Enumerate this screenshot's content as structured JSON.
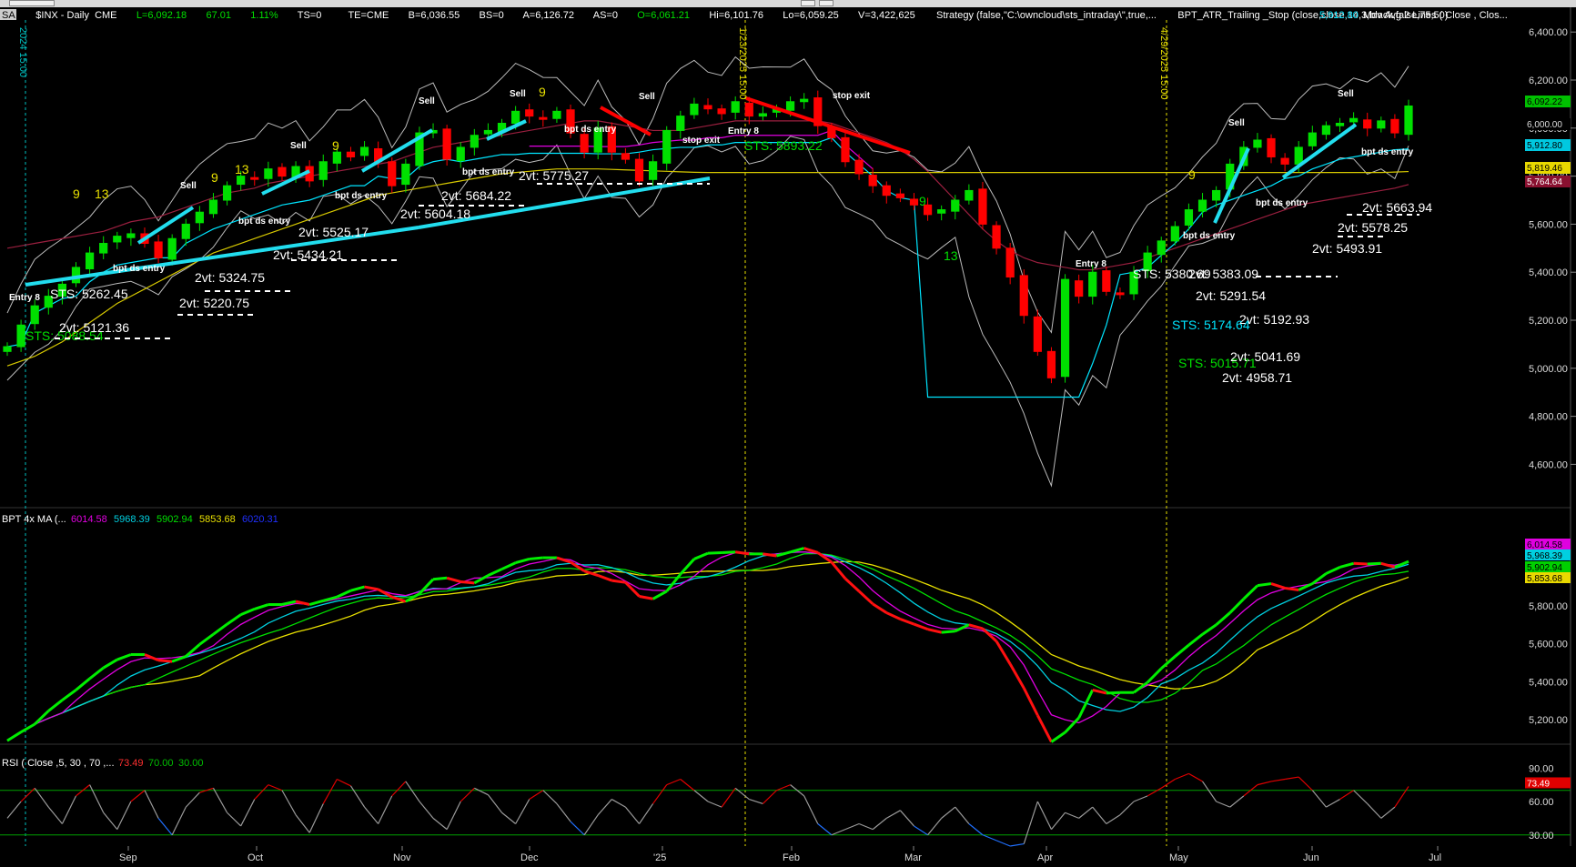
{
  "toolbar": {
    "tag": "SA"
  },
  "header": {
    "symbol": "$INX - Daily  CME",
    "last": "L=6,092.18",
    "change": "67.01",
    "change_pct": "1.11%",
    "ts": "TS=0",
    "te": "TE=CME",
    "bid": "B=6,036.55",
    "bs": "BS=0",
    "ask": "A=6,126.72",
    "as": "AS=0",
    "open": "O=6,061.21",
    "high": "Hi=6,101.76",
    "low": "Lo=6,059.25",
    "volume": "V=3,422,625",
    "strategy": "Strategy (false,\"C:\\owncloud\\sts_intraday\\\",true,...",
    "atr_stop": "BPT_ATR_Trailing _Stop (close,close,14,3,black,false,75,50)",
    "atr_value": "5,912.80",
    "mov_avg": "Mov Avg 2 Lines ( Close , Clos..."
  },
  "colors": {
    "background": "#000000",
    "up_candle": "#00e000",
    "down_candle": "#ff0000",
    "trailing_stop": "#00e5ff",
    "sma200": "#d6c800",
    "sma50": "#9a1f3f",
    "bollinger": "#bbbbbb",
    "magenta": "#e000e0",
    "trendline": "#22ddee"
  },
  "chart_data": [
    {
      "type": "candlestick",
      "title": "$INX - Daily",
      "ylim": [
        4450,
        6450
      ],
      "y_ticks": [
        "6,400.00",
        "6,200.00",
        "6,000.00",
        "5,800.00",
        "5,600.00",
        "5,400.00",
        "5,200.00",
        "5,000.00",
        "4,800.00",
        "4,600.00"
      ],
      "x_ticks": [
        "Sep",
        "Oct",
        "Nov",
        "Dec",
        "'25",
        "Feb",
        "Mar",
        "Apr",
        "May",
        "Jun",
        "Jul"
      ],
      "right_badges": [
        {
          "text": "6,092.22",
          "bg": "#00c000",
          "fg": "#000"
        },
        {
          "text": "6,000.00",
          "bg": "#000",
          "fg": "#ddd"
        },
        {
          "text": "5,912.80",
          "bg": "#00c8e0",
          "fg": "#000"
        },
        {
          "text": "5,819.46",
          "bg": "#e8d800",
          "fg": "#000"
        },
        {
          "text": "5,764.64",
          "bg": "#8a1030",
          "fg": "#fff"
        }
      ],
      "date_markers": [
        "2024 15:00",
        "1/23/2025 15:00",
        "4/29/2025 15:00"
      ],
      "series": [
        {
          "name": "Close",
          "values": [
            5090,
            5180,
            5260,
            5300,
            5350,
            5420,
            5480,
            5520,
            5550,
            5560,
            5520,
            5460,
            5540,
            5600,
            5650,
            5700,
            5760,
            5800,
            5790,
            5830,
            5800,
            5840,
            5780,
            5860,
            5900,
            5880,
            5920,
            5860,
            5760,
            5850,
            5980,
            5990,
            5870,
            5920,
            5970,
            5990,
            6020,
            6070,
            6050,
            6040,
            6070,
            5980,
            5900,
            6000,
            5900,
            5870,
            5780,
            5860,
            5990,
            6050,
            6100,
            6080,
            6060,
            6110,
            6050,
            6060,
            6080,
            6110,
            6120,
            6010,
            5960,
            5860,
            5810,
            5760,
            5720,
            5710,
            5680,
            5640,
            5660,
            5700,
            5740,
            5600,
            5500,
            5380,
            5220,
            5070,
            4960,
            5370,
            5300,
            5400,
            5320,
            5310,
            5400,
            5480,
            5530,
            5590,
            5660,
            5700,
            5740,
            5850,
            5920,
            5950,
            5880,
            5850,
            5920,
            5980,
            6010,
            6020,
            6040,
            6000,
            6030,
            5980,
            6092
          ]
        },
        {
          "name": "ATR Trailing Stop",
          "values": [
            5090,
            5100,
            5230,
            5260,
            5290,
            5300,
            5360,
            5400,
            5430,
            5440,
            5450,
            5460,
            5460,
            5520,
            5550,
            5580,
            5600,
            5620,
            5640,
            5660,
            5680,
            5690,
            5700,
            5720,
            5740,
            5760,
            5760,
            5800,
            5790,
            5790,
            5840,
            5860,
            5870,
            5860,
            5870,
            5880,
            5890,
            5890,
            5895,
            5895,
            5895,
            5895,
            5895,
            5893,
            5893,
            5893,
            5900,
            5910,
            5915,
            5920,
            5920,
            5930,
            5930,
            5940,
            5940,
            5940,
            5940,
            5940,
            5940,
            5940,
            5960,
            5900,
            5850,
            5800,
            5740,
            5710,
            5700,
            4880,
            4880,
            4880,
            4880,
            4880,
            4880,
            4880,
            4880,
            4880,
            4880,
            4880,
            4880,
            5020,
            5180,
            5390,
            5400,
            5420,
            5470,
            5520,
            5580,
            5650,
            5680,
            5700,
            5720,
            5740,
            5760,
            5790,
            5800,
            5830,
            5850,
            5870,
            5880,
            5890,
            5900,
            5910,
            5913
          ]
        },
        {
          "name": "SMA 200",
          "values": [
            5010,
            5030,
            5050,
            5080,
            5110,
            5150,
            5190,
            5230,
            5270,
            5300,
            5330,
            5360,
            5390,
            5420,
            5450,
            5480,
            5500,
            5520,
            5540,
            5560,
            5580,
            5600,
            5620,
            5640,
            5660,
            5680,
            5700,
            5720,
            5730,
            5740,
            5750,
            5760,
            5770,
            5780,
            5790,
            5800,
            5810,
            5815,
            5820,
            5825,
            5830,
            5830,
            5830,
            5830,
            5828,
            5826,
            5824,
            5822,
            5820,
            5818,
            5816,
            5815,
            5815,
            5815,
            5815,
            5815,
            5815,
            5815,
            5815,
            5815,
            5815,
            5815,
            5815,
            5815,
            5815,
            5815,
            5815,
            5815,
            5815,
            5815,
            5815,
            5815,
            5815,
            5815,
            5815,
            5815,
            5815,
            5815,
            5815,
            5815,
            5815,
            5815,
            5815,
            5815,
            5815,
            5815,
            5815,
            5815,
            5815,
            5815,
            5815,
            5815,
            5815,
            5815,
            5815,
            5815,
            5815,
            5815,
            5815,
            5815,
            5815,
            5817,
            5819
          ]
        },
        {
          "name": "SMA 50",
          "values": [
            5500,
            5510,
            5520,
            5530,
            5540,
            5550,
            5560,
            5570,
            5590,
            5610,
            5620,
            5630,
            5650,
            5670,
            5690,
            5710,
            5730,
            5740,
            5750,
            5770,
            5780,
            5790,
            5800,
            5810,
            5820,
            5830,
            5840,
            5850,
            5860,
            5880,
            5900,
            5920,
            5930,
            5940,
            5950,
            5960,
            5970,
            5980,
            5990,
            6000,
            6010,
            6020,
            6030,
            6030,
            6020,
            6010,
            6000,
            5990,
            5990,
            5990,
            6000,
            6010,
            6020,
            6030,
            6030,
            6030,
            6030,
            6030,
            6030,
            6030,
            6020,
            6000,
            5980,
            5960,
            5940,
            5910,
            5870,
            5820,
            5760,
            5700,
            5640,
            5580,
            5530,
            5490,
            5460,
            5440,
            5430,
            5420,
            5410,
            5410,
            5420,
            5430,
            5440,
            5460,
            5480,
            5500,
            5520,
            5540,
            5560,
            5580,
            5600,
            5620,
            5640,
            5660,
            5680,
            5690,
            5700,
            5710,
            5720,
            5730,
            5740,
            5750,
            5765
          ]
        }
      ],
      "annotations": [
        "Entry 8",
        "STS: 5262.45",
        "STS: 5088.54",
        "2vt: 5121.36",
        "2vt: 5220.75",
        "2vt: 5324.75",
        "2vt: 5434.21",
        "2vt: 5525.17",
        "2vt: 5604.18",
        "2vt: 5684.22",
        "2vt: 5775.27",
        "STS: 5893.22",
        "stop exit",
        "Entry 8",
        "STS: 5380.69",
        "2vt: 5383.09",
        "2vt: 5291.54",
        "2vt: 5192.93",
        "STS: 5174.64",
        "STS: 5015.71",
        "2vt: 5041.69",
        "2vt: 4958.71",
        "2vt: 5663.94",
        "2vt: 5578.25",
        "2vt: 5493.91",
        "bpt ds entry",
        "Sell",
        "9",
        "13"
      ]
    },
    {
      "type": "line",
      "title": "BPT 4x MA (...",
      "ylim": [
        5100,
        6250
      ],
      "y_ticks": [
        "5,800.00",
        "5,600.00",
        "5,400.00",
        "5,200.00"
      ],
      "legend_values": [
        {
          "text": "6014.58",
          "color": "#e000e0"
        },
        {
          "text": "5968.39",
          "color": "#00d0e0"
        },
        {
          "text": "5902.94",
          "color": "#00e000"
        },
        {
          "text": "5853.68",
          "color": "#e8e000"
        },
        {
          "text": "6020.31",
          "color": "#2030ff"
        }
      ],
      "right_badges": [
        {
          "text": "6,014.58",
          "bg": "#e000e0",
          "fg": "#000"
        },
        {
          "text": "5,968.39",
          "bg": "#00d0e0",
          "fg": "#000"
        },
        {
          "text": "5,902.94",
          "bg": "#00d000",
          "fg": "#000"
        },
        {
          "text": "5,853.68",
          "bg": "#e8d800",
          "fg": "#000"
        }
      ]
    },
    {
      "type": "line",
      "title": "RSI ( Close ,5, 30 , 70 ,...",
      "ylim": [
        20,
        100
      ],
      "y_ticks": [
        "90.00",
        "60.00",
        "30.00"
      ],
      "levels": [
        70,
        30
      ],
      "legend_values": [
        {
          "text": "73.49",
          "color": "#ff3030"
        },
        {
          "text": "70.00",
          "color": "#00c000"
        },
        {
          "text": "30.00",
          "color": "#00c000"
        }
      ],
      "right_badges": [
        {
          "text": "73.49",
          "bg": "#e00000",
          "fg": "#fff"
        }
      ],
      "values": [
        45,
        60,
        72,
        55,
        40,
        65,
        75,
        50,
        35,
        60,
        70,
        45,
        30,
        55,
        68,
        72,
        50,
        38,
        62,
        75,
        70,
        48,
        32,
        58,
        80,
        74,
        55,
        40,
        65,
        78,
        60,
        45,
        35,
        60,
        72,
        66,
        50,
        40,
        62,
        70,
        58,
        42,
        30,
        48,
        62,
        55,
        40,
        58,
        75,
        80,
        70,
        60,
        55,
        72,
        62,
        58,
        70,
        75,
        65,
        40,
        30,
        35,
        40,
        35,
        45,
        52,
        38,
        30,
        45,
        55,
        40,
        30,
        25,
        20,
        22,
        60,
        35,
        50,
        45,
        55,
        40,
        48,
        60,
        65,
        72,
        80,
        85,
        78,
        60,
        55,
        65,
        75,
        78,
        80,
        82,
        70,
        55,
        62,
        70,
        58,
        45,
        55,
        73.49
      ]
    }
  ]
}
